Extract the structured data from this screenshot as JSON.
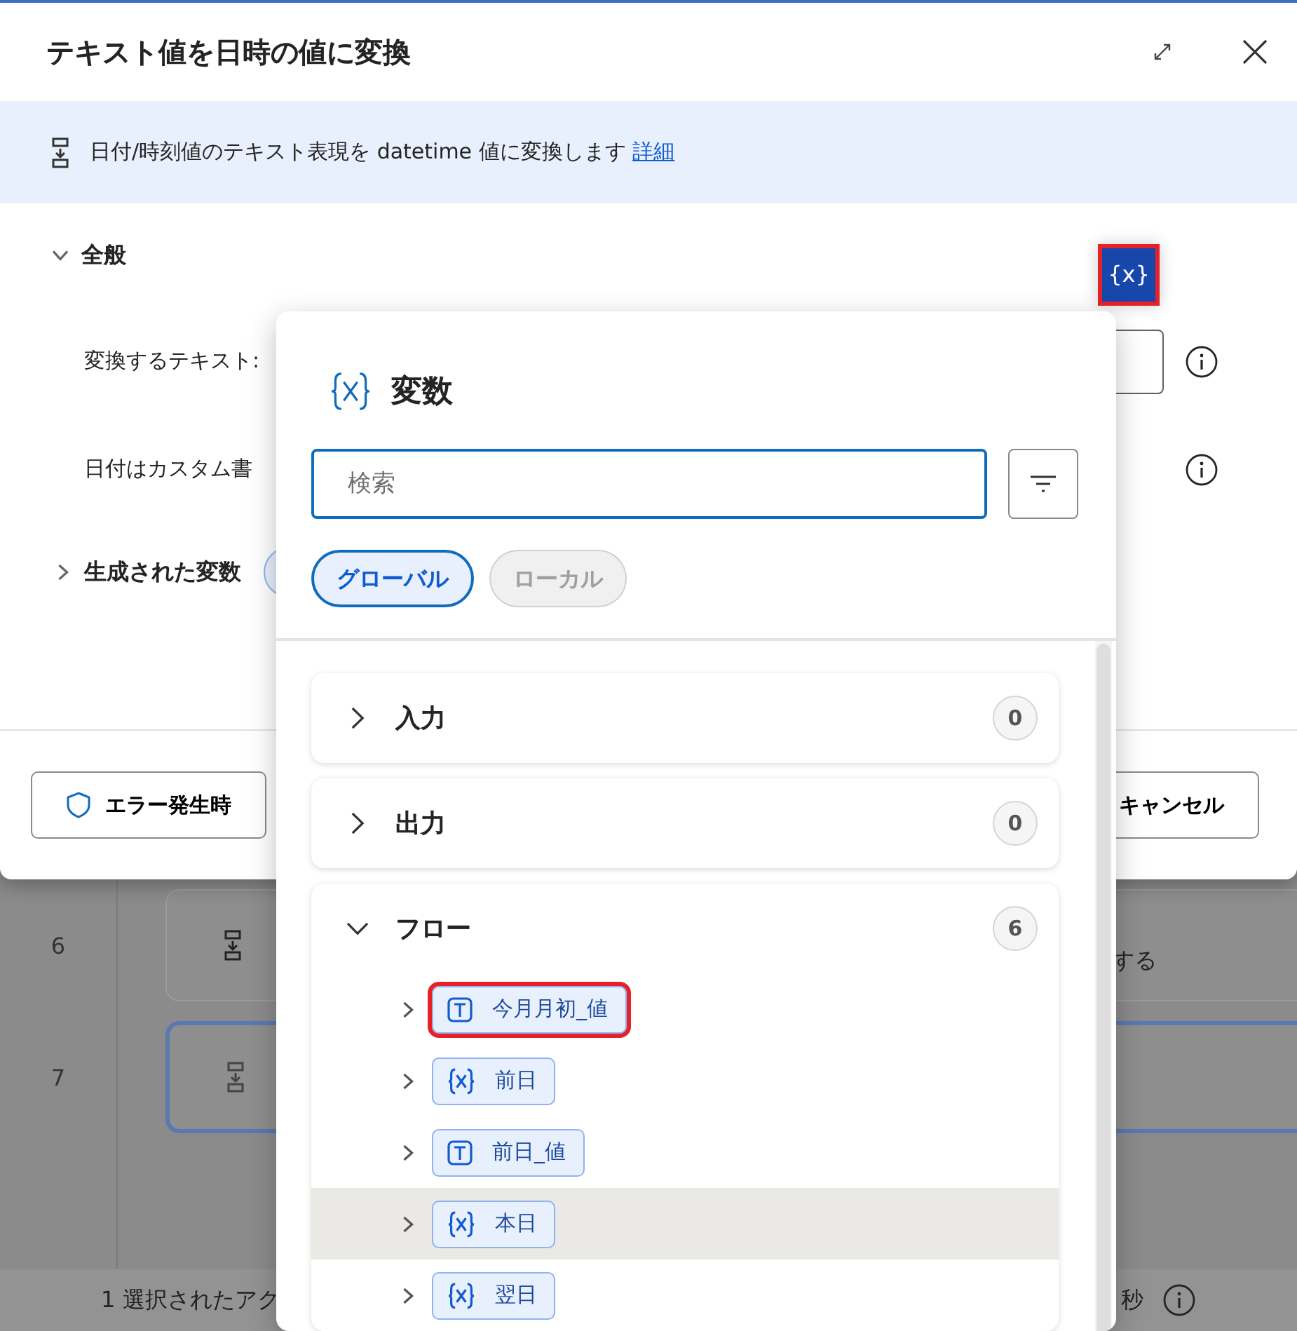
{
  "dialog": {
    "title": "テキスト値を日時の値に変換",
    "banner": {
      "text": "日付/時刻値のテキスト表現を datetime 値に変換します",
      "link": "詳細"
    },
    "section": {
      "title": "全般",
      "expanded": true
    },
    "variable_button": {
      "label": "{x}",
      "highlighted": true
    },
    "fields": [
      {
        "label": "変換するテキスト:"
      },
      {
        "label": "日付はカスタム書"
      }
    ],
    "generated": {
      "title": "生成された変数",
      "expanded": false
    },
    "footer": {
      "error_button": "エラー発生時",
      "cancel_button": "キャンセル"
    }
  },
  "variables_popup": {
    "title": "変数",
    "search": {
      "placeholder": "検索"
    },
    "scopes": [
      {
        "label": "グローバル",
        "selected": true
      },
      {
        "label": "ローカル",
        "selected": false
      }
    ],
    "groups": [
      {
        "label": "入力",
        "count": "0",
        "expanded": false
      },
      {
        "label": "出力",
        "count": "0",
        "expanded": false
      },
      {
        "label": "フロー",
        "count": "6",
        "expanded": true,
        "children": [
          {
            "name": "今月月初_値",
            "kind": "text",
            "highlighted": true,
            "hovered": false
          },
          {
            "name": "前日",
            "kind": "variable",
            "highlighted": false,
            "hovered": false
          },
          {
            "name": "前日_値",
            "kind": "text",
            "highlighted": false,
            "hovered": false
          },
          {
            "name": "本日",
            "kind": "variable",
            "highlighted": false,
            "hovered": true
          },
          {
            "name": "翌日",
            "kind": "variable",
            "highlighted": false,
            "hovered": false
          }
        ]
      }
    ]
  },
  "background": {
    "rows": [
      {
        "number": "6",
        "text": "する",
        "selected": false
      },
      {
        "number": "7",
        "selected": true
      }
    ],
    "status": {
      "left": "1 選択されたアク",
      "right": "秒"
    }
  }
}
